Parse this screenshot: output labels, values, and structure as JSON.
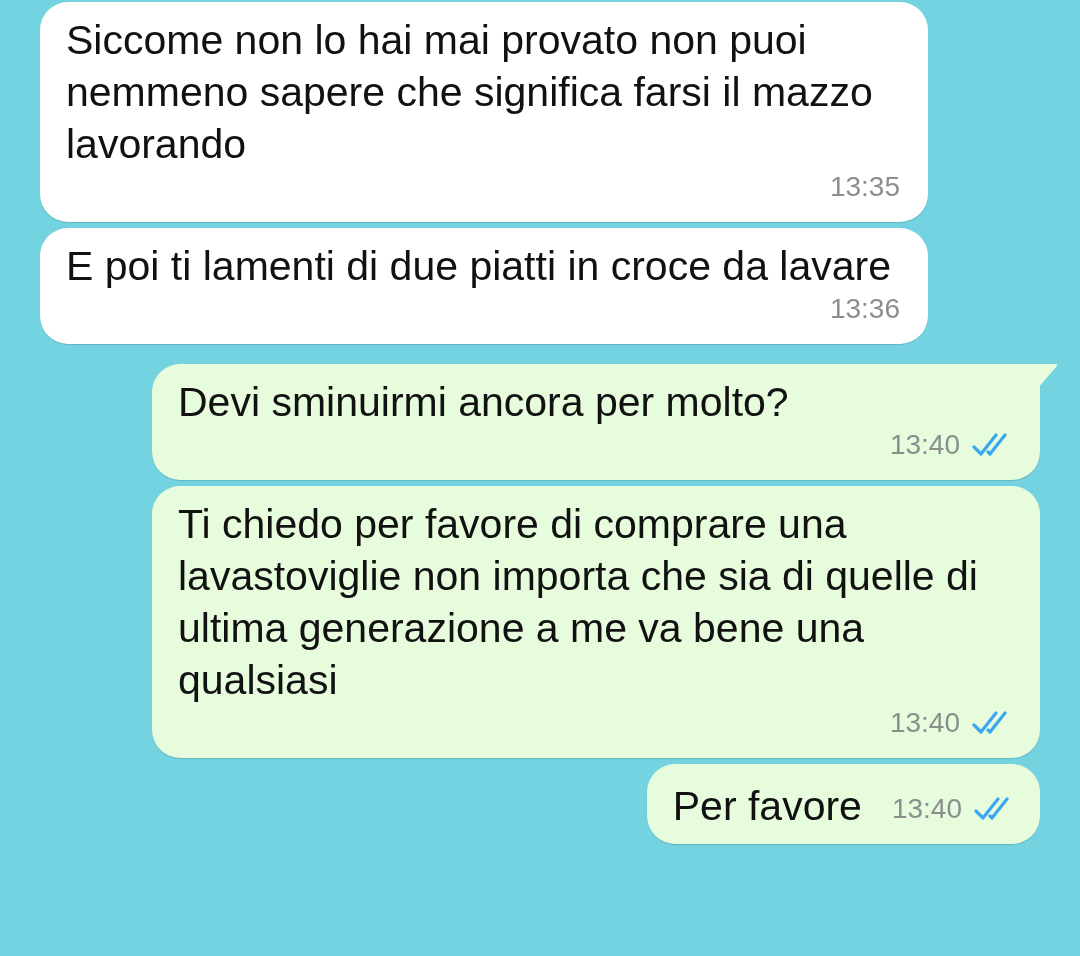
{
  "messages": [
    {
      "kind": "incoming",
      "text": "Siccome non lo hai mai provato non puoi nemmeno sapere che significa farsi il mazzo lavorando",
      "time": "13:35",
      "tail": false
    },
    {
      "kind": "incoming",
      "text": "E poi ti lamenti di due piatti in croce da lavare",
      "time": "13:36",
      "tail": false
    },
    {
      "kind": "outgoing",
      "text": "Devi sminuirmi ancora per molto?",
      "time": "13:40",
      "tail": true,
      "read": true
    },
    {
      "kind": "outgoing",
      "text": "Ti chiedo per favore di comprare una lavastoviglie non importa che sia di quelle di ultima generazione a me va bene una qualsiasi",
      "time": "13:40",
      "tail": false,
      "read": true
    },
    {
      "kind": "compact",
      "text": "Per favore",
      "time": "13:40",
      "tail": false,
      "read": true
    }
  ]
}
